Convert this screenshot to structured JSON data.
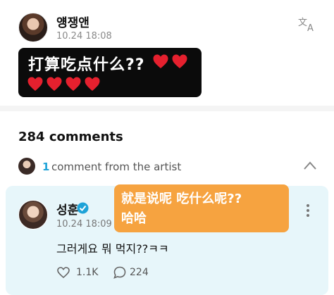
{
  "post": {
    "author": "얭쟁앤",
    "time": "10.24 18:08",
    "caption_line1": "打算吃点什么??",
    "hearts_row1": 2,
    "hearts_row2": 4,
    "translate_icon": "translate-icon"
  },
  "comments": {
    "count_label": "284 comments",
    "artist_count": "1",
    "artist_label": "comment from the artist"
  },
  "artist_comment": {
    "author": "성훈",
    "time": "10.24 18:09",
    "text": "그러게요 뭐 먹지??ㅋㅋ",
    "likes": "1.1K",
    "replies": "224",
    "caption_line1": "就是说呢 吃什么呢??",
    "caption_line2": "哈哈"
  },
  "colors": {
    "accent": "#1ea3d8",
    "comment_bg": "#e7f6fa",
    "caption_orange": "#f6a340",
    "heart": "#e5202e"
  }
}
